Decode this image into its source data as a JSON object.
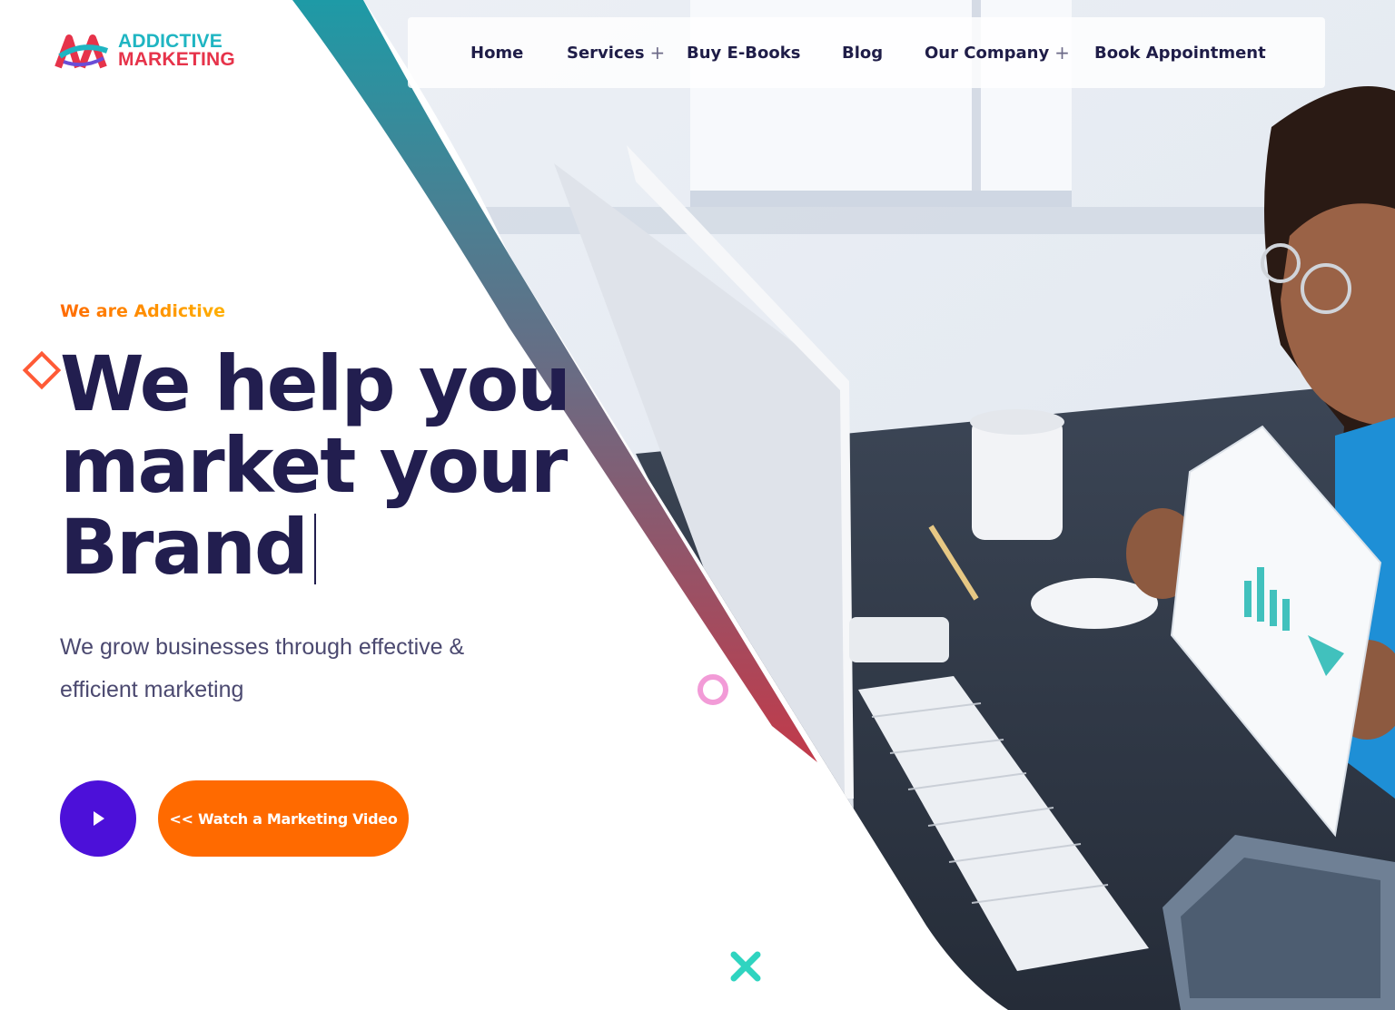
{
  "brand": {
    "line1": "ADDICTIVE",
    "line2": "MARKETING",
    "logo_icon": "addictive-marketing-logo-icon",
    "colors": {
      "teal": "#1fb5c2",
      "red": "#e6334a"
    }
  },
  "nav": {
    "items": [
      {
        "label": "Home",
        "has_submenu": false
      },
      {
        "label": "Services",
        "has_submenu": true
      },
      {
        "label": "Buy E-Books",
        "has_submenu": false
      },
      {
        "label": "Blog",
        "has_submenu": false
      },
      {
        "label": "Our Company",
        "has_submenu": true
      },
      {
        "label": "Book Appointment",
        "has_submenu": false
      }
    ],
    "submenu_indicator": "+"
  },
  "hero": {
    "eyebrow": "We are Addictive",
    "headline_lines": [
      "We help you",
      "market your",
      "Brand"
    ],
    "subtext": "We grow businesses through effective & efficient marketing",
    "play_icon": "play-icon",
    "video_button_label": "<< Watch a Marketing Video"
  },
  "colors": {
    "heading": "#221e4f",
    "body_text": "#4b4970",
    "accent_orange": "#ff6a00",
    "accent_purple": "#4c10d9",
    "deco_diamond": "#ff5a36",
    "deco_circle": "#f29bd7",
    "deco_cross": "#2fd4c0"
  }
}
